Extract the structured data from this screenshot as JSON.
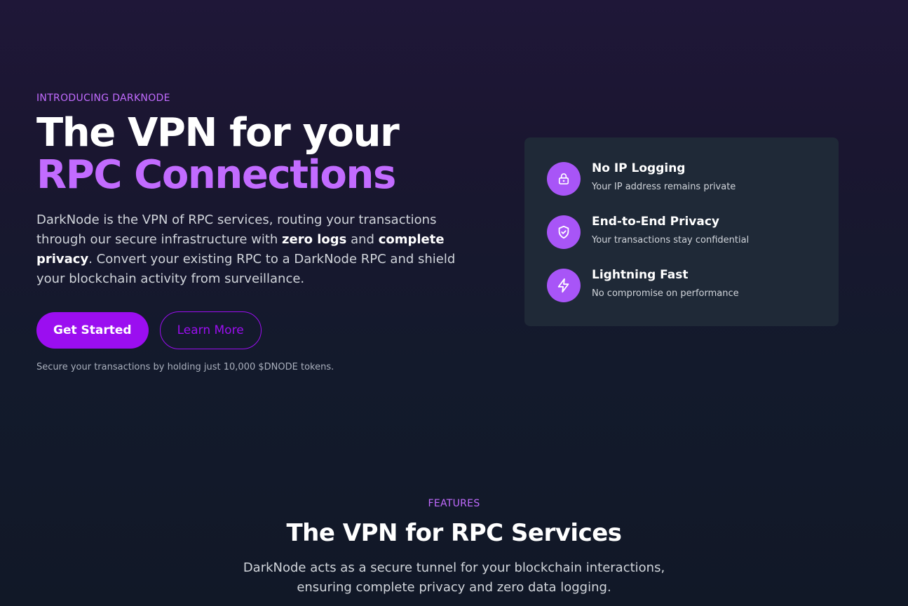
{
  "hero": {
    "eyebrow": "INTRODUCING DARKNODE",
    "headline_line1": "The VPN for your",
    "headline_line2": "RPC Connections",
    "lead_part1": "DarkNode is the VPN of RPC services, routing your transactions through our secure infrastructure with ",
    "lead_bold1": "zero logs",
    "lead_part2": " and ",
    "lead_bold2": "complete privacy",
    "lead_part3": ". Convert your existing RPC to a DarkNode RPC and shield your blockchain activity from surveillance.",
    "primary_button": "Get Started",
    "secondary_button": "Learn More",
    "note": "Secure your transactions by holding just 10,000 $DNODE tokens."
  },
  "card": {
    "features": [
      {
        "icon": "lock-icon",
        "title": "No IP Logging",
        "description": "Your IP address remains private"
      },
      {
        "icon": "shield-check-icon",
        "title": "End-to-End Privacy",
        "description": "Your transactions stay confidential"
      },
      {
        "icon": "lightning-icon",
        "title": "Lightning Fast",
        "description": "No compromise on performance"
      }
    ]
  },
  "features_section": {
    "eyebrow": "FEATURES",
    "title": "The VPN for RPC Services",
    "subtitle": "DarkNode acts as a secure tunnel for your blockchain interactions, ensuring complete privacy and zero data logging."
  },
  "colors": {
    "accent": "#c26bff",
    "primary": "#9b0ef0",
    "icon_bg": "#a855f7",
    "card_bg": "#1f2937"
  }
}
